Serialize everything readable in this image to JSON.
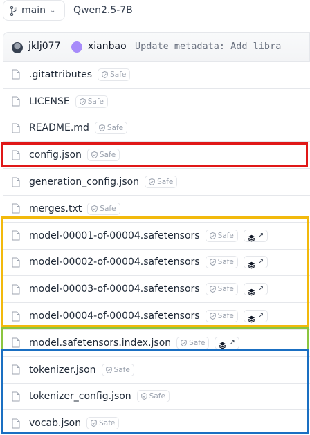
{
  "header": {
    "branch_label": "main",
    "repo_name": "Qwen2.5-7B"
  },
  "commit": {
    "user1": "jklj077",
    "user2": "xianbao",
    "message": "Update metadata: Add libra"
  },
  "badges": {
    "safe_label": "Safe"
  },
  "files": [
    {
      "name": ".gitattributes",
      "tensor_badge": false
    },
    {
      "name": "LICENSE",
      "tensor_badge": false
    },
    {
      "name": "README.md",
      "tensor_badge": false
    },
    {
      "name": "config.json",
      "tensor_badge": false
    },
    {
      "name": "generation_config.json",
      "tensor_badge": false
    },
    {
      "name": "merges.txt",
      "tensor_badge": false
    },
    {
      "name": "model-00001-of-00004.safetensors",
      "tensor_badge": true
    },
    {
      "name": "model-00002-of-00004.safetensors",
      "tensor_badge": true
    },
    {
      "name": "model-00003-of-00004.safetensors",
      "tensor_badge": true
    },
    {
      "name": "model-00004-of-00004.safetensors",
      "tensor_badge": true
    },
    {
      "name": "model.safetensors.index.json",
      "tensor_badge": true
    },
    {
      "name": "tokenizer.json",
      "tensor_badge": false
    },
    {
      "name": "tokenizer_config.json",
      "tensor_badge": false
    },
    {
      "name": "vocab.json",
      "tensor_badge": false
    }
  ],
  "highlight_colors": {
    "red": "#e01818",
    "yellow": "#f2b90c",
    "green": "#8bc53f",
    "blue": "#1a6fc2"
  }
}
